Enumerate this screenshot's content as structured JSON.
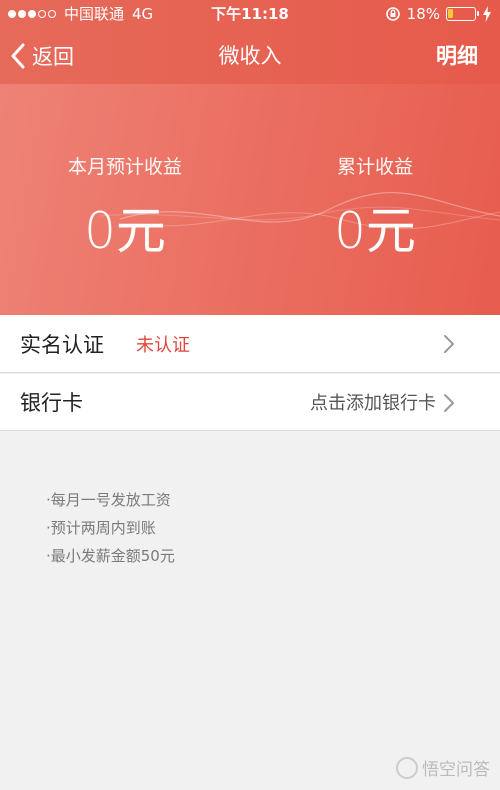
{
  "status_bar": {
    "carrier": "中国联通",
    "network": "4G",
    "time": "下午11:18",
    "battery": "18%",
    "battery_level": 0.18
  },
  "nav": {
    "back_label": "返回",
    "title": "微收入",
    "detail_label": "明细"
  },
  "summary": {
    "month_label": "本月预计收益",
    "month_value": "0元",
    "total_label": "累计收益",
    "total_value": "0元"
  },
  "rows": [
    {
      "title": "实名认证",
      "status": "未认证"
    },
    {
      "title": "银行卡",
      "action": "点击添加银行卡"
    }
  ],
  "notes": [
    "·每月一号发放工资",
    "·预计两周内到账",
    "·最小发薪金额50元"
  ],
  "watermark": "悟空问答",
  "colors": {
    "accent": "#e65a4b",
    "warning": "#e0463b",
    "battery": "#f7c83a"
  }
}
